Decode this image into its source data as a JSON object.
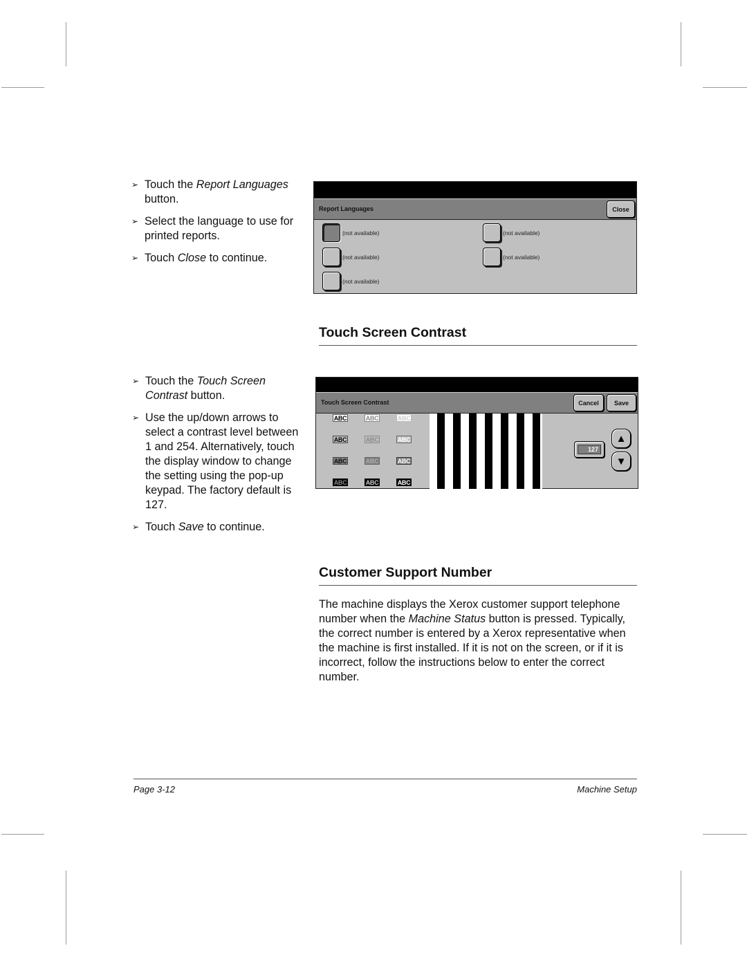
{
  "report_languages_section": {
    "steps": [
      {
        "prefix": "Touch the ",
        "em": "Report Languages",
        "suffix": " button."
      },
      {
        "prefix": "Select the language to use for printed reports.",
        "em": "",
        "suffix": ""
      },
      {
        "prefix": "Touch ",
        "em": "Close",
        "suffix": " to continue."
      }
    ],
    "screen": {
      "title": "Report Languages",
      "close_label": "Close",
      "options": [
        {
          "label": "(not available)",
          "selected": true
        },
        {
          "label": "(not available)",
          "selected": false
        },
        {
          "label": "(not available)",
          "selected": false
        },
        {
          "label": "(not available)",
          "selected": false
        },
        {
          "label": "(not available)",
          "selected": false
        }
      ]
    }
  },
  "touch_screen_contrast_section": {
    "heading": "Touch Screen Contrast",
    "steps": [
      {
        "prefix": "Touch the ",
        "em": "Touch Screen Contrast",
        "suffix": " button."
      },
      {
        "prefix": "Use the up/down arrows to select a contrast level between 1 and 254. Alternatively, touch the display window to change the setting using the pop-up keypad. The factory default is 127.",
        "em": "",
        "suffix": ""
      },
      {
        "prefix": "Touch ",
        "em": "Save",
        "suffix": " to continue."
      }
    ],
    "screen": {
      "title": "Touch Screen Contrast",
      "cancel_label": "Cancel",
      "save_label": "Save",
      "swatch_text": "ABC",
      "contrast_value": "127",
      "up_icon": "up-arrow-icon",
      "down_icon": "down-arrow-icon"
    }
  },
  "customer_support_section": {
    "heading": "Customer Support Number",
    "para_part1": "The machine displays the Xerox customer support telephone number when the ",
    "para_em": "Machine Status",
    "para_part2": " button is pressed. Typically, the correct number is entered by a Xerox representative when the machine is first installed. If it is not on the screen, or if it is incorrect, follow the instructions below to enter the correct number."
  },
  "footer": {
    "page": "Page 3-12",
    "section": "Machine Setup"
  },
  "bullet_glyph": "➢"
}
